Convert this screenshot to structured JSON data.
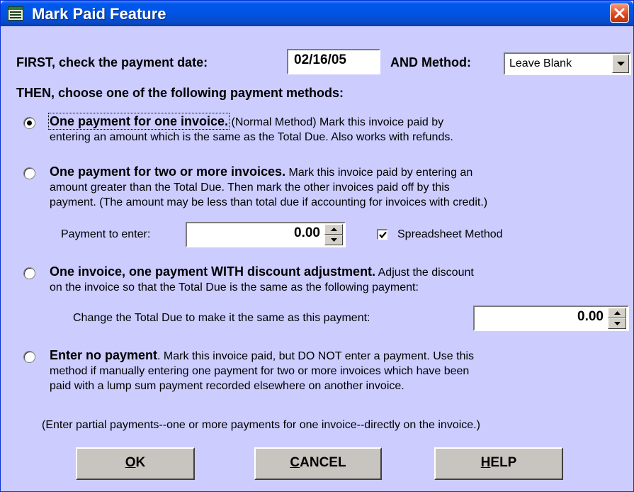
{
  "window": {
    "title": "Mark Paid Feature",
    "app_icon": "form-icon",
    "close_icon": "close-icon"
  },
  "first_row": {
    "label": "FIRST, check the payment date:",
    "date_value": "02/16/05",
    "method_label": "AND Method:",
    "method_selected": "Leave Blank"
  },
  "then_label": "THEN, choose one of the following payment methods:",
  "options": [
    {
      "selected": true,
      "heading": "One payment for one invoice.",
      "line1_rest": " (Normal Method)  Mark this invoice paid by",
      "line2": "entering an amount which is the same as the Total Due.  Also works with refunds."
    },
    {
      "selected": false,
      "heading": "One payment for two or more invoices.",
      "line1_rest": " Mark this invoice paid by entering an",
      "line2": "amount greater than the Total Due.  Then mark the other invoices paid off by this",
      "line3": "payment. (The amount may be less than total due if accounting for invoices with credit.)"
    },
    {
      "selected": false,
      "heading": "One invoice, one payment WITH discount adjustment.",
      "line1_rest": "  Adjust the discount",
      "line2": "on the invoice so that the Total Due is the same as the following payment:"
    },
    {
      "selected": false,
      "heading": "Enter no payment",
      "line1_rest": ".  Mark this invoice paid, but DO NOT enter a payment.  Use this",
      "line2": "method if manually entering one payment for two or more invoices which have been",
      "line3": "paid with a lump sum payment recorded elsewhere on another invoice."
    }
  ],
  "payment_to_enter": {
    "label": "Payment to enter:",
    "value": "0.00"
  },
  "spreadsheet": {
    "label": "Spreadsheet Method",
    "checked": true
  },
  "change_total": {
    "label": "Change the Total Due to make it the same as this payment:",
    "value": "0.00"
  },
  "note": "(Enter partial payments--one or more payments for one invoice--directly on the invoice.)",
  "buttons": {
    "ok": {
      "mnemonic": "O",
      "rest": "K"
    },
    "cancel": {
      "mnemonic": "C",
      "rest": "ANCEL"
    },
    "help": {
      "mnemonic": "H",
      "rest": "ELP"
    }
  },
  "colors": {
    "dialog_bg": "#ccccff",
    "titlebar": "#0054e3",
    "close": "#d9461f"
  }
}
